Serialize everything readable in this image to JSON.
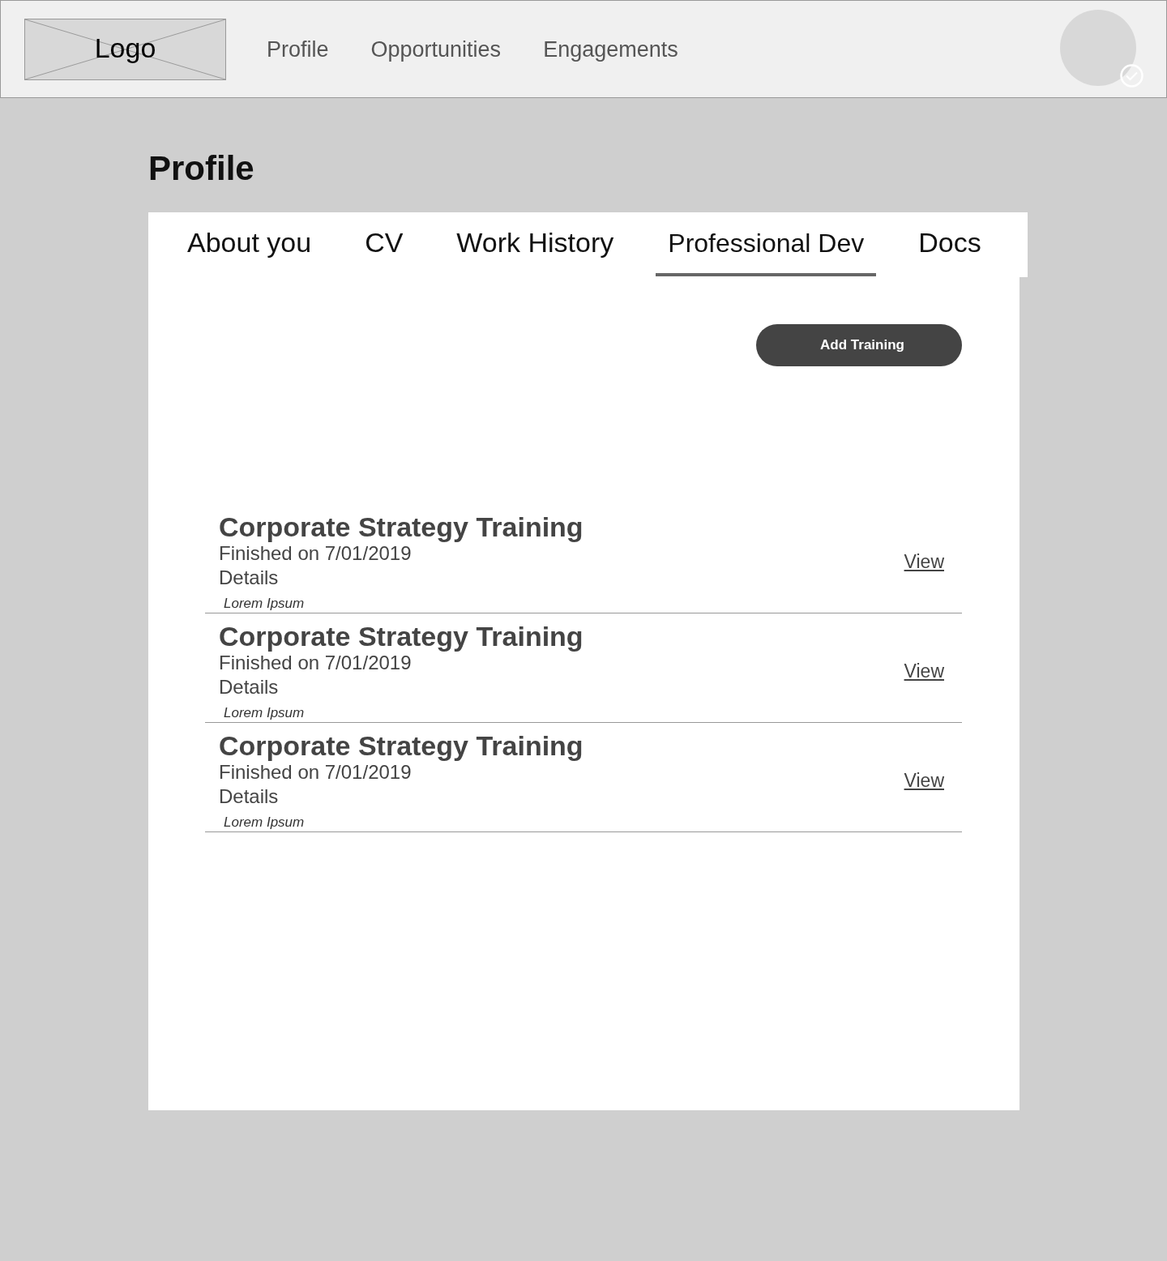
{
  "header": {
    "logo": "Logo",
    "nav": [
      {
        "label": "Profile"
      },
      {
        "label": "Opportunities"
      },
      {
        "label": "Engagements"
      }
    ]
  },
  "page_title": "Profile",
  "tabs": [
    {
      "label": "About you",
      "selected": false
    },
    {
      "label": "CV",
      "selected": false
    },
    {
      "label": "Work History",
      "selected": false
    },
    {
      "label": "Professional Dev",
      "selected": true
    },
    {
      "label": "Docs",
      "selected": false
    }
  ],
  "add_button": "Add Training",
  "trainings": [
    {
      "title": "Corporate Strategy Training",
      "finished": "Finished on 7/01/2019",
      "details_label": "Details",
      "details": "Lorem Ipsum",
      "link": "View"
    },
    {
      "title": "Corporate Strategy Training",
      "finished": "Finished on 7/01/2019",
      "details_label": "Details",
      "details": "Lorem Ipsum",
      "link": "View"
    },
    {
      "title": "Corporate Strategy Training",
      "finished": "Finished on 7/01/2019",
      "details_label": "Details",
      "details": "Lorem Ipsum",
      "link": "View"
    }
  ]
}
